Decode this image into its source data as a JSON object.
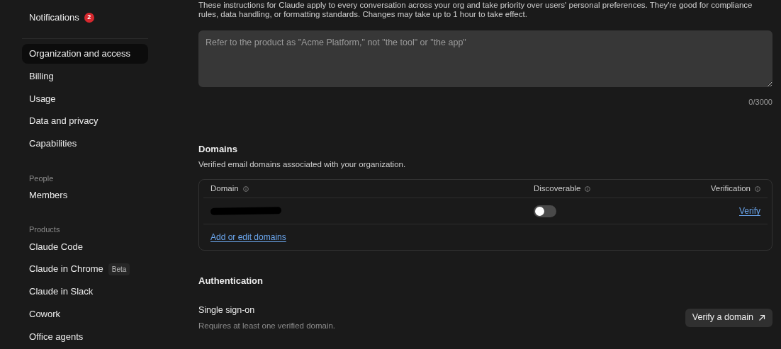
{
  "sidebar": {
    "items": [
      {
        "kind": "item",
        "label": "Notifications",
        "badge": "2",
        "selected": false
      },
      {
        "kind": "divider"
      },
      {
        "kind": "item",
        "label": "Organization and access",
        "selected": true
      },
      {
        "kind": "item",
        "label": "Billing",
        "selected": false
      },
      {
        "kind": "item",
        "label": "Usage",
        "selected": false
      },
      {
        "kind": "item",
        "label": "Data and privacy",
        "selected": false
      },
      {
        "kind": "item",
        "label": "Capabilities",
        "selected": false
      },
      {
        "kind": "heading",
        "label": "People"
      },
      {
        "kind": "item",
        "label": "Members",
        "selected": false
      },
      {
        "kind": "heading",
        "label": "Products"
      },
      {
        "kind": "item",
        "label": "Claude Code",
        "selected": false
      },
      {
        "kind": "item",
        "label": "Claude in Chrome",
        "tag": "Beta",
        "selected": false
      },
      {
        "kind": "item",
        "label": "Claude in Slack",
        "selected": false
      },
      {
        "kind": "item",
        "label": "Cowork",
        "selected": false
      },
      {
        "kind": "item",
        "label": "Office agents",
        "selected": false
      }
    ]
  },
  "instructions": {
    "description": "These instructions for Claude apply to every conversation across your org and take priority over users' personal preferences. They're good for compliance rules, data handling, or formatting standards. Changes may take up to 1 hour to take effect.",
    "placeholder": "Refer to the product as \"Acme Platform,\" not \"the tool\" or \"the app\"",
    "counter": "0/3000"
  },
  "domains": {
    "title": "Domains",
    "subtitle": "Verified email domains associated with your organization.",
    "columns": [
      "Domain",
      "Discoverable",
      "Verification"
    ],
    "rows": [
      {
        "redacted": true,
        "discoverable": false,
        "action": "Verify"
      }
    ],
    "add_link": "Add or edit domains"
  },
  "authentication": {
    "title": "Authentication",
    "sso_title": "Single sign-on",
    "sso_subtitle": "Requires at least one verified domain.",
    "button": "Verify a domain"
  }
}
